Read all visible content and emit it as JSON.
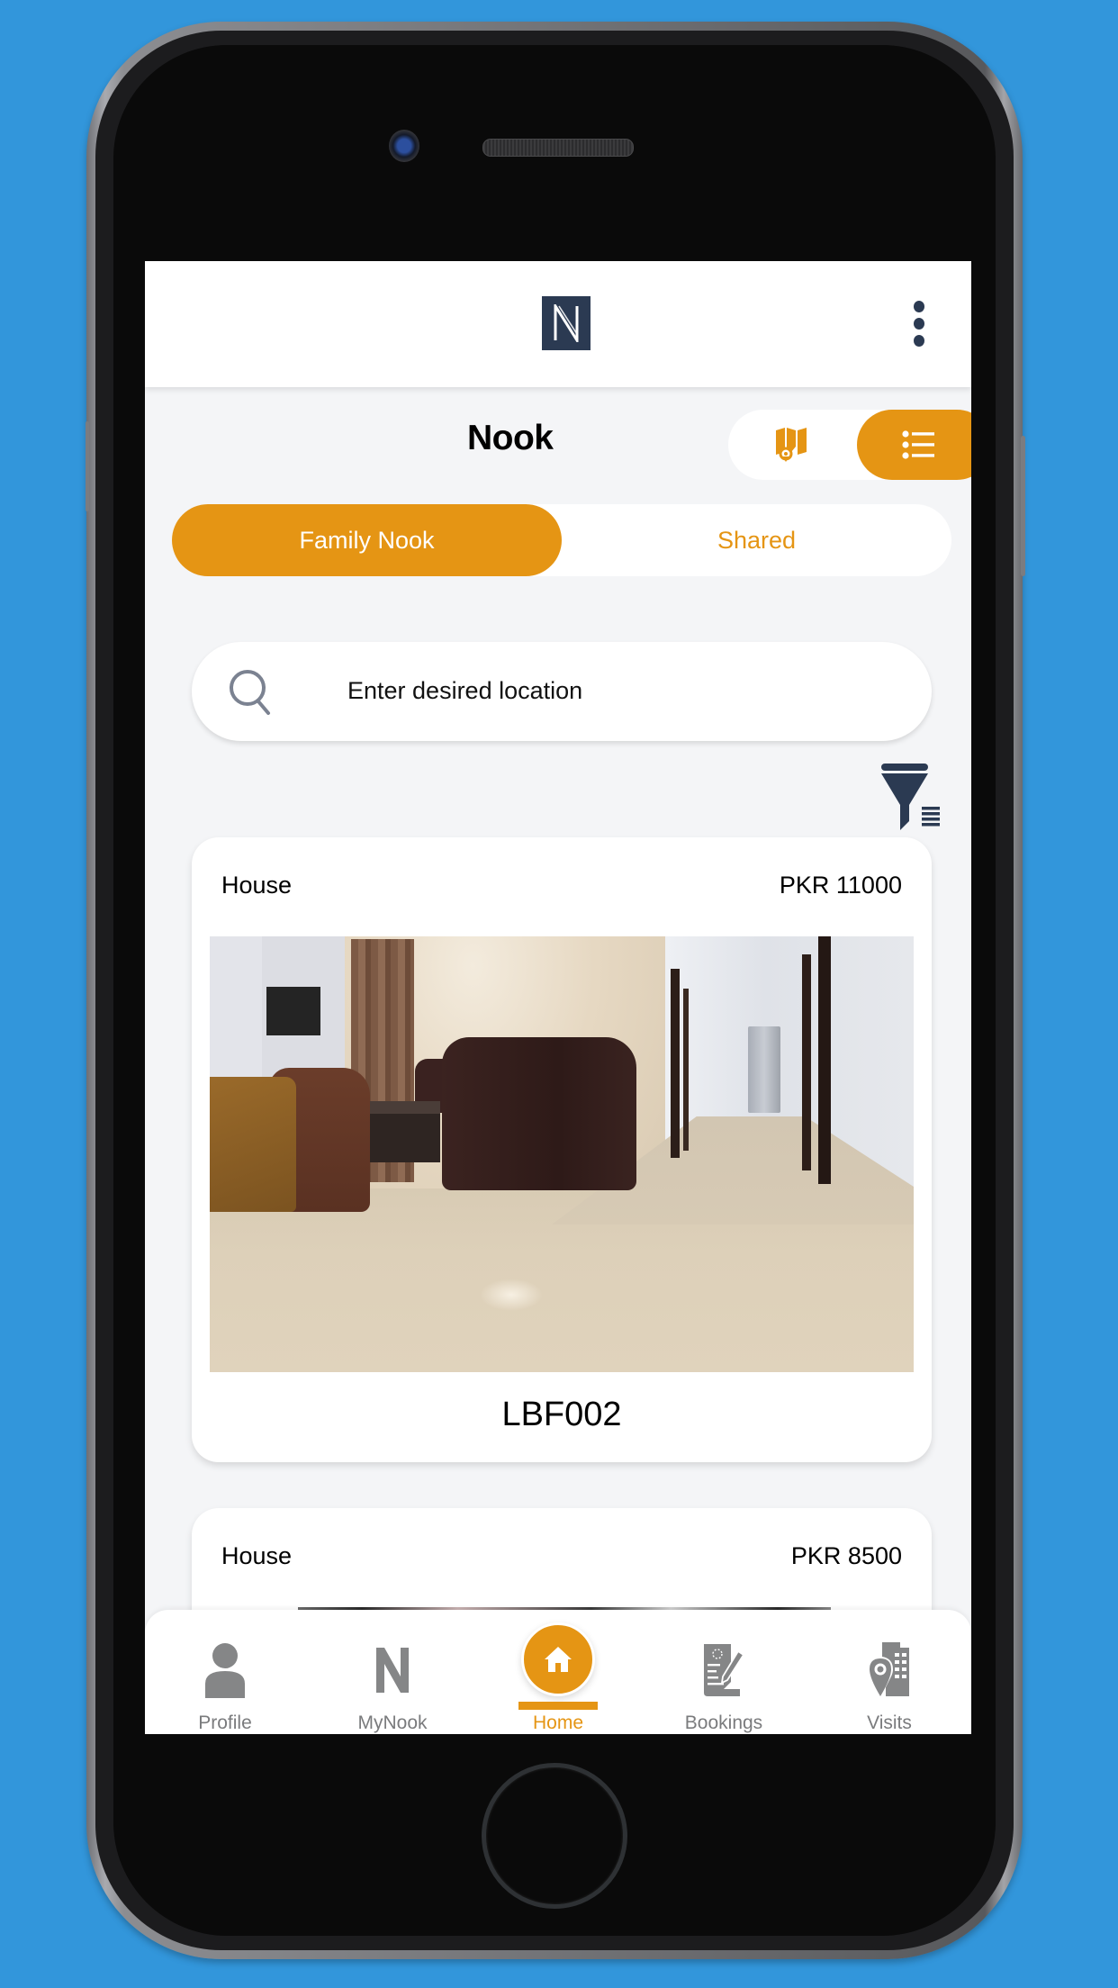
{
  "app": {
    "logo_letter": "N",
    "menu_icon": "kebab-menu-icon"
  },
  "header": {
    "title": "Nook",
    "view_toggle": {
      "options": [
        {
          "name": "map",
          "icon": "map-pin-icon",
          "active": false
        },
        {
          "name": "list",
          "icon": "list-icon",
          "active": true
        }
      ]
    }
  },
  "segment": {
    "options": [
      {
        "label": "Family Nook",
        "active": true
      },
      {
        "label": "Shared",
        "active": false
      }
    ]
  },
  "search": {
    "placeholder": "Enter desired location",
    "icon": "search-icon"
  },
  "filter": {
    "icon": "filter-icon"
  },
  "listings": [
    {
      "type": "House",
      "price": "PKR 11000",
      "code": "LBF002",
      "image": "living-room-photo"
    },
    {
      "type": "House",
      "price": "PKR 8500",
      "code": "",
      "image": "room-photo"
    }
  ],
  "bottom_nav": {
    "items": [
      {
        "label": "Profile",
        "icon": "person-icon",
        "active": false
      },
      {
        "label": "MyNook",
        "icon": "n-letter-icon",
        "active": false
      },
      {
        "label": "Home",
        "icon": "home-icon",
        "active": true
      },
      {
        "label": "Bookings",
        "icon": "document-pen-icon",
        "active": false
      },
      {
        "label": "Visits",
        "icon": "building-pin-icon",
        "active": false
      }
    ]
  },
  "colors": {
    "accent": "#e59514",
    "brand_dark": "#2b3a52",
    "background": "#f4f5f7",
    "nav_inactive": "#7a7b7d",
    "outer_background": "#3296db"
  }
}
